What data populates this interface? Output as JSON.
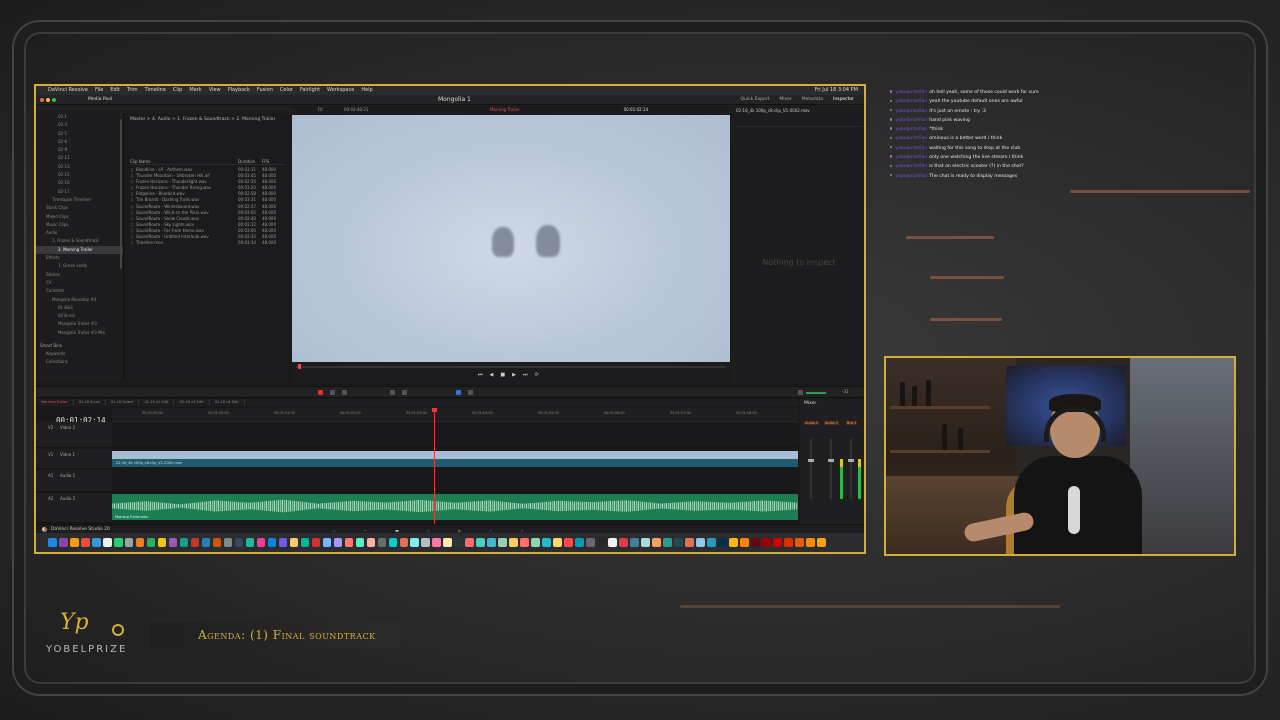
{
  "menubar": {
    "items": [
      "DaVinci Resolve",
      "File",
      "Edit",
      "Trim",
      "Timeline",
      "Clip",
      "Mark",
      "View",
      "Playback",
      "Fusion",
      "Color",
      "Fairlight",
      "Workspace",
      "Help"
    ],
    "clock": "Fri Jul 18 3:04 PM"
  },
  "toolbar": {
    "media_pool": "Media Pool",
    "project": "Mongolia 1",
    "tabs": [
      "Quick Export",
      "Mixer",
      "Metadata",
      "Inspector"
    ]
  },
  "bins": [
    {
      "name": "02-1",
      "level": 3
    },
    {
      "name": "02-3",
      "level": 3
    },
    {
      "name": "02-5",
      "level": 3
    },
    {
      "name": "02-6",
      "level": 3
    },
    {
      "name": "02-9",
      "level": 3
    },
    {
      "name": "02-11",
      "level": 3
    },
    {
      "name": "02-13",
      "level": 3
    },
    {
      "name": "02-15",
      "level": 3
    },
    {
      "name": "02-16",
      "level": 3
    },
    {
      "name": "02-17",
      "level": 3
    },
    {
      "name": "Timelapse Timeline",
      "level": 2
    },
    {
      "name": "Stock Clips",
      "level": 1
    },
    {
      "name": "Mixed Clips",
      "level": 1
    },
    {
      "name": "Music Clips",
      "level": 1
    },
    {
      "name": "Audio",
      "level": 1
    },
    {
      "name": "1. Frozen & Soundtrack",
      "level": 2
    },
    {
      "name": "2. Morning Trailer",
      "level": 3,
      "selected": true
    },
    {
      "name": "Effects",
      "level": 1
    },
    {
      "name": "1. Green Leafy",
      "level": 3
    },
    {
      "name": "Stories",
      "level": 1
    },
    {
      "name": "CV",
      "level": 1
    },
    {
      "name": "Contents",
      "level": 1
    },
    {
      "name": "Mongolia Roundup #4",
      "level": 2
    },
    {
      "name": "01 B&S",
      "level": 3
    },
    {
      "name": "02 B-roll",
      "level": 3
    },
    {
      "name": "Mongolia Trailer #3",
      "level": 3
    },
    {
      "name": "Mongolia Trailer #3 Mix",
      "level": 3
    }
  ],
  "sidebar_sections": {
    "smart_bins": "Smart Bins",
    "smart_items": [
      "Keywords",
      "Collections"
    ]
  },
  "clip_panel": {
    "breadcrumb": "Master > 4. Audio > 1. Frozen & Soundtrack > 2. Morning Trailer",
    "columns": [
      "Clip Name",
      "Duration",
      "FPS"
    ],
    "clips": [
      {
        "name": "Bloodline - LP - Anthem.wav",
        "dur": "00:03:11",
        "fps": "48.000"
      },
      {
        "name": "Thunder Mountain - Unbroken Hill.aif",
        "dur": "00:03:45",
        "fps": "48.000"
      },
      {
        "name": "Frozen Horizons - Thunderlight.wav",
        "dur": "00:02:54",
        "fps": "48.000"
      },
      {
        "name": "Frozen Horizons - Thunder Rising.wav",
        "dur": "00:03:20",
        "fps": "48.000"
      },
      {
        "name": "Ridgeline - Bluebird.wav",
        "dur": "00:02:58",
        "fps": "48.000"
      },
      {
        "name": "Tim Brandt - Dashing Trails.wav",
        "dur": "00:03:31",
        "fps": "48.000"
      },
      {
        "name": "SoundRoute - Winterbound.wav",
        "dur": "00:02:47",
        "fps": "48.000"
      },
      {
        "name": "SoundRoute - Wind on the Plain.wav",
        "dur": "00:03:05",
        "fps": "48.000"
      },
      {
        "name": "SoundRoute - Snow Clouds.wav",
        "dur": "00:02:40",
        "fps": "48.000"
      },
      {
        "name": "SoundRoute - Sky Lights.wav",
        "dur": "00:03:12",
        "fps": "48.000"
      },
      {
        "name": "SoundRoute - Far From Home.wav",
        "dur": "00:03:00",
        "fps": "48.000"
      },
      {
        "name": "SoundRoute - Untitled Interlude.wav",
        "dur": "00:02:33",
        "fps": "48.000"
      },
      {
        "name": "Timeline.mov",
        "dur": "00:03:14",
        "fps": "48.000"
      }
    ]
  },
  "viewer": {
    "zoom": "Fit",
    "tc_left": "00:03:48:21",
    "clip_title": "Morning Trailer",
    "tc_right": "00:01:02:14"
  },
  "inspector": {
    "filename": "02-16_4k 100p_c8.clip_V1-0002.mov",
    "empty": "Nothing to inspect"
  },
  "timeline": {
    "timecode": "00:01:02:14",
    "tabs": [
      "Morning Trailer",
      "02-16 B-roll",
      "02-16 Select",
      "02-15 v2 Edit",
      "02-16 v3 Edit",
      "02-18 v4 Edit"
    ],
    "ticks": [
      "00:00:59:00",
      "00:01:00:00",
      "00:01:01:00",
      "00:01:02:00",
      "00:01:03:00",
      "00:01:04:00",
      "00:01:05:00",
      "00:01:06:00",
      "00:01:07:00",
      "00:01:08:00"
    ],
    "tracks": [
      {
        "id": "V2",
        "name": "Video 2"
      },
      {
        "id": "V1",
        "name": "Video 1"
      },
      {
        "id": "A1",
        "name": "Audio 1"
      },
      {
        "id": "A2",
        "name": "Audio 2"
      }
    ],
    "video_clip_label": "02-16_4k 100p_c8.clip_V1-0002.mov",
    "audio_clip_label": "Morning Trailer.wav",
    "volume": "-31",
    "progress_playhead": 0.47
  },
  "mixer": {
    "title": "Mixer",
    "strips": [
      "Audio 1",
      "Audio 2",
      "Bus 1"
    ]
  },
  "status_bar": {
    "label": "DaVinci Resolve Studio 20"
  },
  "dock_colors": [
    "#1e88e5",
    "#8e44ad",
    "#f39c12",
    "#e74c3c",
    "#3498db",
    "#ecf0f1",
    "#2ecc71",
    "#95a5a6",
    "#e67e22",
    "#27ae60",
    "#f1c40f",
    "#9b59b6",
    "#16a085",
    "#c0392b",
    "#2980b9",
    "#d35400",
    "#7f8c8d",
    "#34495e",
    "#1abc9c",
    "#e84393",
    "#0984e3",
    "#6c5ce7",
    "#fdcb6e",
    "#00b894",
    "#d63031",
    "#74b9ff",
    "#a29bfe",
    "#ff7675",
    "#55efc4",
    "#fab1a0",
    "#636e72",
    "#00cec9",
    "#e17055",
    "#81ecec",
    "#b2bec3",
    "#fd79a8",
    "#ffeaa7",
    "#2d3436",
    "#ff6b6b",
    "#4ecdc4",
    "#45b7d1",
    "#96ceb4",
    "#ffcc5c",
    "#ff6f69",
    "#88d8b0",
    "#2ab7ca",
    "#fed766",
    "#fe4a49",
    "#009fb7",
    "#696773",
    "#272727",
    "#eff1f3",
    "#e63946",
    "#457b9d",
    "#a8dadc",
    "#f4a261",
    "#2a9d8f",
    "#264653",
    "#e76f51",
    "#8ecae6",
    "#219ebc",
    "#023047",
    "#ffb703",
    "#fb8500",
    "#6a040f",
    "#9d0208",
    "#d00000",
    "#dc2f02",
    "#e85d04",
    "#f48c06",
    "#faa307"
  ],
  "chat": [
    {
      "user": "yobelprizeFan",
      "text": "oh hell yeah, some of those could work for sure"
    },
    {
      "user": "yobelprizeFan",
      "text": "yeah the youtube default ones are awful"
    },
    {
      "user": "yobelprizeFan",
      "text": "it's just an emote : try :3"
    },
    {
      "user": "yobelprizeFan",
      "text": "hand pink waving"
    },
    {
      "user": "yobelprizeFan",
      "text": "*think"
    },
    {
      "user": "yobelprizeFan",
      "text": "ominous is a better word i think"
    },
    {
      "user": "yobelprizeFan",
      "text": "waiting for this song to drop at the club"
    },
    {
      "user": "yobelprizeFan",
      "text": "only one watching the live stream i think"
    },
    {
      "user": "yobelprizeFan",
      "text": "is that an electric scooter (?) in the shot?"
    },
    {
      "user": "yobelprizeFan",
      "text": "The chat is ready to display messages"
    }
  ],
  "brand": {
    "name": "YOBELPRIZE",
    "mark": "Yp"
  },
  "agenda": {
    "text": "Agenda: (1) Final soundtrack"
  }
}
